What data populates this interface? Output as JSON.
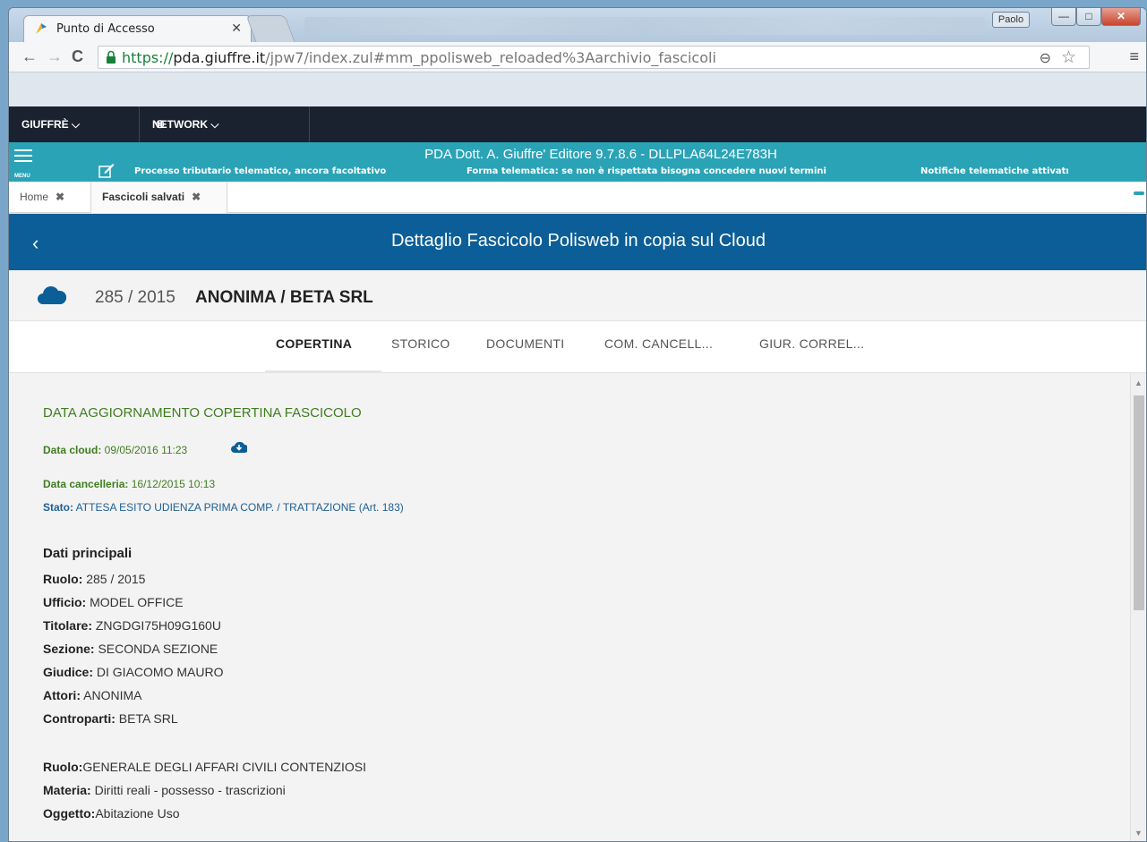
{
  "browser": {
    "tab_title": "Punto di Accesso",
    "tab_close": "✕",
    "user_badge": "Paolo",
    "url_scheme": "https://",
    "url_host": "pda.giuffre.it",
    "url_path": "/jpw7/index.zul#mm_ppolisweb_reloaded%3Aarchivio_fascicoli",
    "buttons": {
      "minimize": "—",
      "maximize": "□",
      "close": "✕"
    }
  },
  "topnav": {
    "giuffre": "GIUFFRÈ ⌵",
    "network": "NETWORK ⌵"
  },
  "banner": {
    "menu_label": "MENU",
    "title": "PDA Dott. A. Giuffre' Editore 9.7.8.6   -   DLLPLA64L24E783H",
    "tickers": [
      "Processo tributario telematico, ancora facoltativo",
      "Forma telematica: se non è rispettata bisogna concedere nuovi termini",
      "Notifiche telematiche attivatı"
    ]
  },
  "app_tabs": [
    {
      "label": "Home",
      "close": "✖"
    },
    {
      "label": "Fascicoli salvati",
      "close": "✖"
    }
  ],
  "header": {
    "back": "‹",
    "title": "Dettaglio Fascicolo Polisweb in copia sul Cloud"
  },
  "case": {
    "number": "285 / 2015",
    "parties": "ANONIMA / BETA SRL"
  },
  "section_tabs": [
    "COPERTINA",
    "STORICO",
    "DOCUMENTI",
    "COM. CANCELL...",
    "GIUR. CORREL..."
  ],
  "cover": {
    "heading": "DATA AGGIORNAMENTO COPERTINA FASCICOLO",
    "data_cloud_label": "Data cloud:",
    "data_cloud_value": " 09/05/2016 11:23",
    "data_cancelleria_label": "Data cancelleria:",
    "data_cancelleria_value": " 16/12/2015 10:13",
    "stato_label": "Stato:",
    "stato_value": " ATTESA ESITO UDIENZA PRIMA COMP. / TRATTAZIONE (Art. 183)"
  },
  "main_data": {
    "heading": "Dati principali",
    "rows": [
      {
        "label": "Ruolo:",
        "value": " 285 / 2015"
      },
      {
        "label": "Ufficio:",
        "value": " MODEL OFFICE"
      },
      {
        "label": "Titolare:",
        "value": " ZNGDGI75H09G160U"
      },
      {
        "label": "Sezione:",
        "value": " SECONDA SEZIONE"
      },
      {
        "label": "Giudice:",
        "value": " DI GIACOMO MAURO"
      },
      {
        "label": "Attori:",
        "value": " ANONIMA"
      },
      {
        "label": "Controparti:",
        "value": " BETA SRL"
      },
      {
        "label": "Ruolo:",
        "value": "GENERALE DEGLI AFFARI CIVILI CONTENZIOSI"
      },
      {
        "label": "Materia:",
        "value": " Diritti reali - possesso - trascrizioni"
      },
      {
        "label": "Oggetto:",
        "value": "Abitazione Uso"
      }
    ]
  }
}
